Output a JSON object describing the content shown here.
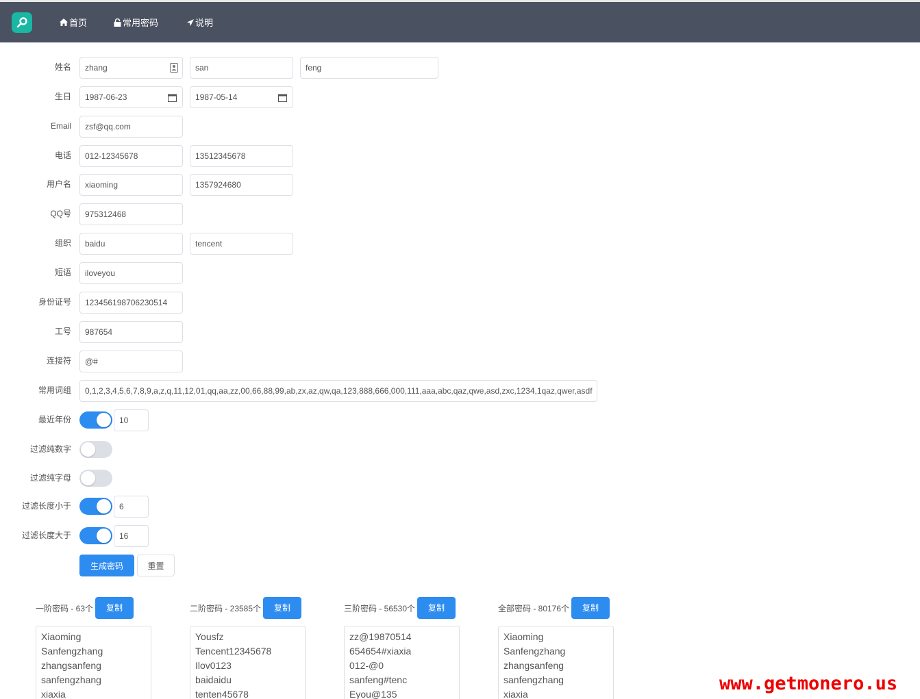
{
  "nav": {
    "items": [
      {
        "label": "首页",
        "icon": "home-icon"
      },
      {
        "label": "常用密码",
        "icon": "lock-icon"
      },
      {
        "label": "说明",
        "icon": "send-icon"
      }
    ]
  },
  "form": {
    "name_label": "姓名",
    "name_values": [
      "zhang",
      "san",
      "feng"
    ],
    "birthday_label": "生日",
    "birthday_values": [
      "1987-06-23",
      "1987-05-14"
    ],
    "email_label": "Email",
    "email_value": "zsf@qq.com",
    "phone_label": "电话",
    "phone_values": [
      "012-12345678",
      "13512345678"
    ],
    "username_label": "用户名",
    "username_values": [
      "xiaoming",
      "1357924680"
    ],
    "qq_label": "QQ号",
    "qq_value": "975312468",
    "org_label": "组织",
    "org_values": [
      "baidu",
      "tencent"
    ],
    "phrase_label": "短语",
    "phrase_value": "iloveyou",
    "idcard_label": "身份证号",
    "idcard_value": "123456198706230514",
    "workid_label": "工号",
    "workid_value": "987654",
    "connector_label": "连接符",
    "connector_value": "@#",
    "words_label": "常用词组",
    "words_value": "0,1,2,3,4,5,6,7,8,9,a,z,q,11,12,01,qq,aa,zz,00,66,88,99,ab,zx,az,qw,qa,123,888,666,000,111,aaa,abc,qaz,qwe,asd,zxc,1234,1qaz,qwer,asdf",
    "recent_years_label": "最近年份",
    "recent_years_on": true,
    "recent_years_value": "10",
    "filter_digits_label": "过滤纯数字",
    "filter_digits_on": false,
    "filter_letters_label": "过滤纯字母",
    "filter_letters_on": false,
    "filter_min_label": "过滤长度小于",
    "filter_min_on": true,
    "filter_min_value": "6",
    "filter_max_label": "过滤长度大于",
    "filter_max_on": true,
    "filter_max_value": "16",
    "generate_label": "生成密码",
    "reset_label": "重置"
  },
  "results": [
    {
      "title": "一阶密码 - 63个",
      "copy": "复制",
      "items": [
        "Xiaoming",
        "Sanfengzhang",
        "zhangsanfeng",
        "sanfengzhang",
        "xiaxia"
      ]
    },
    {
      "title": "二阶密码 - 23585个",
      "copy": "复制",
      "items": [
        "Yousfz",
        "Tencent12345678",
        "Ilov0123",
        "baidaidu",
        "tenten45678"
      ]
    },
    {
      "title": "三阶密码 - 56530个",
      "copy": "复制",
      "items": [
        "zz@19870514",
        "654654#xiaxia",
        "012-@0",
        "sanfeng#tenc",
        "Eyou@135"
      ]
    },
    {
      "title": "全部密码 - 80176个",
      "copy": "复制",
      "items": [
        "Xiaoming",
        "Sanfengzhang",
        "zhangsanfeng",
        "sanfengzhang",
        "xiaxia"
      ]
    }
  ],
  "watermark": "www.getmonero.us",
  "colors": {
    "navbar": "#4a5160",
    "accent": "#2d8cf0",
    "logo": "#19b7a4",
    "watermark": "#ee0000"
  }
}
